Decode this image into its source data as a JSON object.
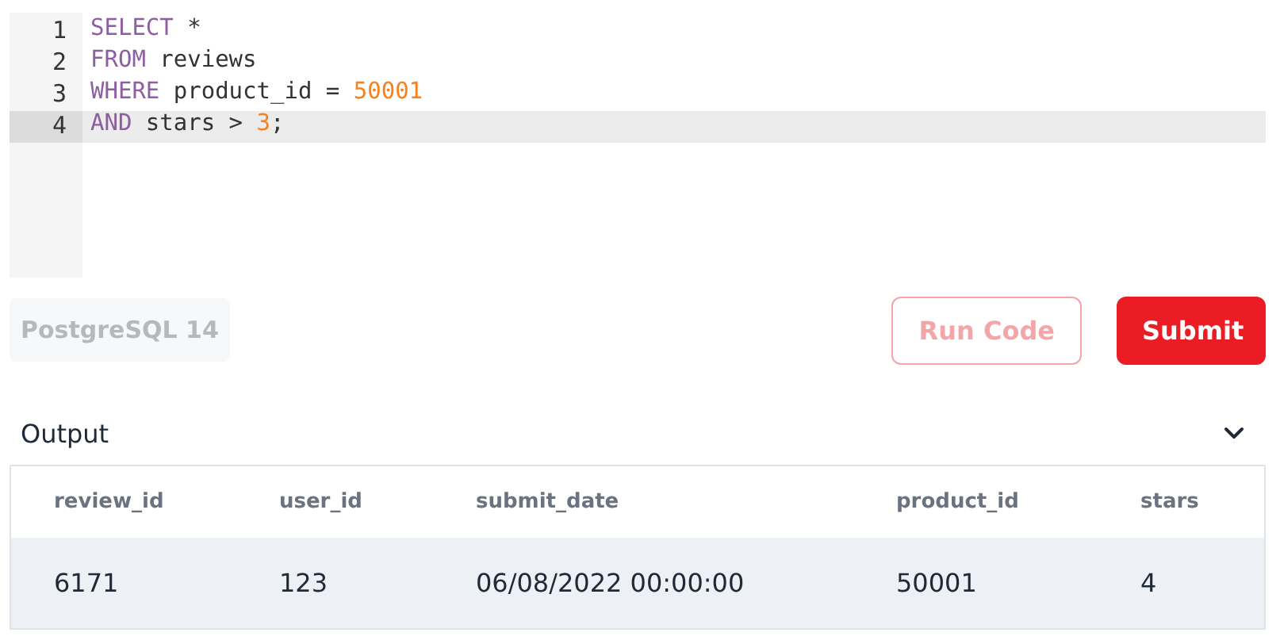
{
  "editor": {
    "lines": [
      {
        "number": "1",
        "selected": false,
        "tokens": [
          {
            "kind": "keyword",
            "text": "SELECT"
          },
          {
            "kind": "plain",
            "text": " *"
          }
        ]
      },
      {
        "number": "2",
        "selected": false,
        "tokens": [
          {
            "kind": "keyword",
            "text": "FROM"
          },
          {
            "kind": "plain",
            "text": " reviews"
          }
        ]
      },
      {
        "number": "3",
        "selected": false,
        "tokens": [
          {
            "kind": "keyword",
            "text": "WHERE"
          },
          {
            "kind": "plain",
            "text": " product_id = "
          },
          {
            "kind": "number",
            "text": "50001"
          }
        ]
      },
      {
        "number": "4",
        "selected": true,
        "tokens": [
          {
            "kind": "keyword",
            "text": "AND"
          },
          {
            "kind": "plain",
            "text": " stars > "
          },
          {
            "kind": "number",
            "text": "3"
          },
          {
            "kind": "plain",
            "text": ";"
          }
        ]
      }
    ]
  },
  "toolbar": {
    "dialect": "PostgreSQL 14",
    "buttons": [
      {
        "label": "Run Code",
        "kind": "outline",
        "disabled": true
      },
      {
        "label": "Submit",
        "kind": "primary",
        "disabled": false
      }
    ]
  },
  "output": {
    "title": "Output",
    "expanded": true,
    "table": {
      "columns": [
        "review_id",
        "user_id",
        "submit_date",
        "product_id",
        "stars"
      ],
      "rows": [
        [
          "6171",
          "123",
          "06/08/2022 00:00:00",
          "50001",
          "4"
        ]
      ]
    }
  }
}
